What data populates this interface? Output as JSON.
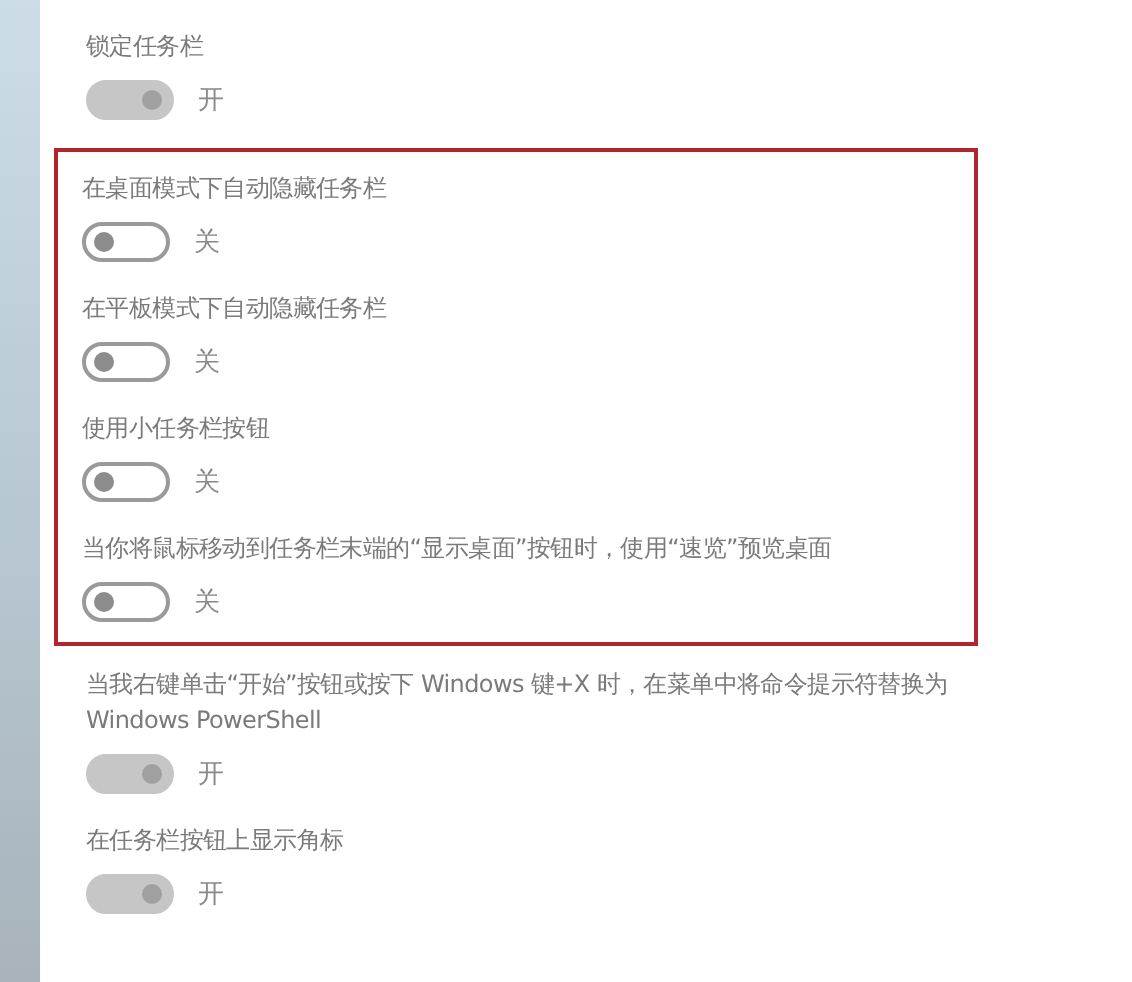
{
  "groups": [
    {
      "highlighted": false,
      "settings": [
        {
          "label": "锁定任务栏",
          "on": true,
          "state_text": "开"
        }
      ]
    },
    {
      "highlighted": true,
      "settings": [
        {
          "label": "在桌面模式下自动隐藏任务栏",
          "on": false,
          "state_text": "关"
        },
        {
          "label": "在平板模式下自动隐藏任务栏",
          "on": false,
          "state_text": "关"
        },
        {
          "label": "使用小任务栏按钮",
          "on": false,
          "state_text": "关"
        },
        {
          "label": "当你将鼠标移动到任务栏末端的“显示桌面”按钮时，使用“速览”预览桌面",
          "on": false,
          "state_text": "关"
        }
      ]
    },
    {
      "highlighted": false,
      "settings": [
        {
          "label": "当我右键单击“开始”按钮或按下 Windows 键+X 时，在菜单中将命令提示符替换为 Windows PowerShell",
          "on": true,
          "state_text": "开"
        },
        {
          "label": "在任务栏按钮上显示角标",
          "on": true,
          "state_text": "开"
        }
      ]
    }
  ]
}
